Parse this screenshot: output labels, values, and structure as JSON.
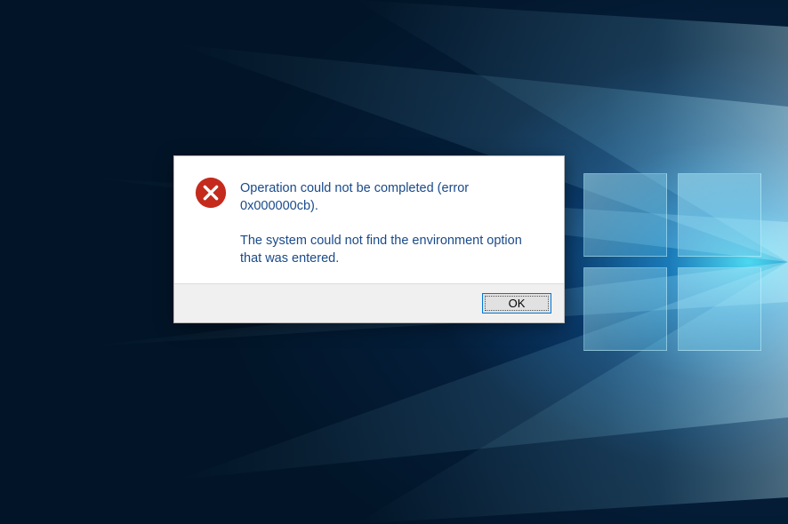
{
  "dialog": {
    "icon": "error-icon",
    "message_primary": "Operation could not be completed (error 0x000000cb).",
    "message_secondary": "The system could not find the environment option that was entered.",
    "ok_label": "OK"
  },
  "colors": {
    "accent": "#0078d7",
    "error": "#c42b1c",
    "text": "#1a4a8a"
  }
}
